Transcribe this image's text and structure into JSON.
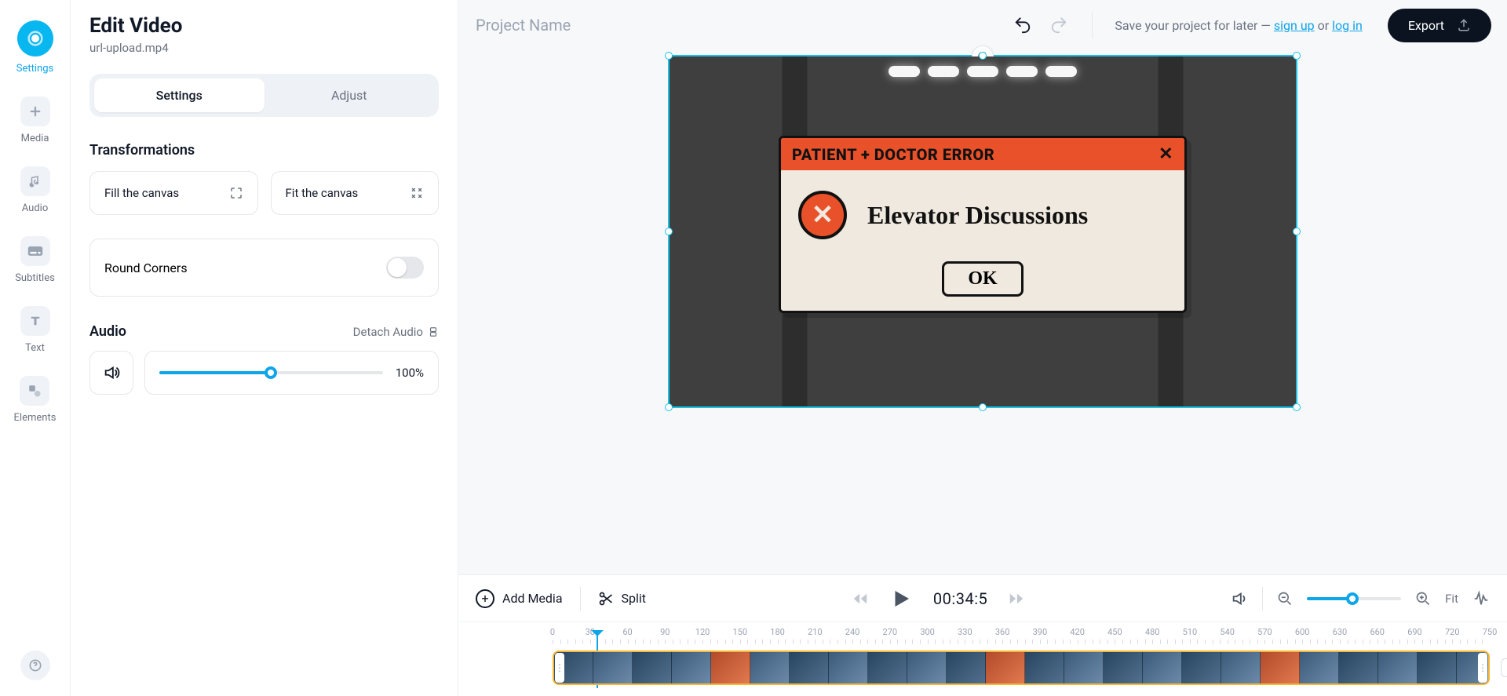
{
  "rail": {
    "settings": "Settings",
    "media": "Media",
    "audio": "Audio",
    "subtitles": "Subtitles",
    "text": "Text",
    "elements": "Elements"
  },
  "panel": {
    "title": "Edit Video",
    "subtitle": "url-upload.mp4",
    "tab_settings": "Settings",
    "tab_adjust": "Adjust",
    "transformations": "Transformations",
    "fill_canvas": "Fill the canvas",
    "fit_canvas": "Fit the canvas",
    "round_corners": "Round Corners",
    "audio": "Audio",
    "detach_audio": "Detach Audio",
    "volume_pct": "100%"
  },
  "topbar": {
    "project_name_placeholder": "Project Name",
    "save_prefix": "Save your project for later — ",
    "sign_up": "sign up",
    "or": " or ",
    "log_in": "log in",
    "export": "Export"
  },
  "preview_dialog": {
    "title": "PATIENT + DOCTOR ERROR",
    "body": "Elevator Discussions",
    "ok": "OK"
  },
  "timeline": {
    "add_media": "Add Media",
    "split": "Split",
    "timecode": "00:34:5",
    "fit": "Fit",
    "ticks": [
      "0",
      "30",
      "60",
      "90",
      "120",
      "150",
      "180",
      "210",
      "240",
      "270",
      "300",
      "330",
      "360",
      "390",
      "420",
      "450",
      "480",
      "510",
      "540",
      "570",
      "600",
      "630",
      "660",
      "690",
      "720",
      "750"
    ]
  }
}
